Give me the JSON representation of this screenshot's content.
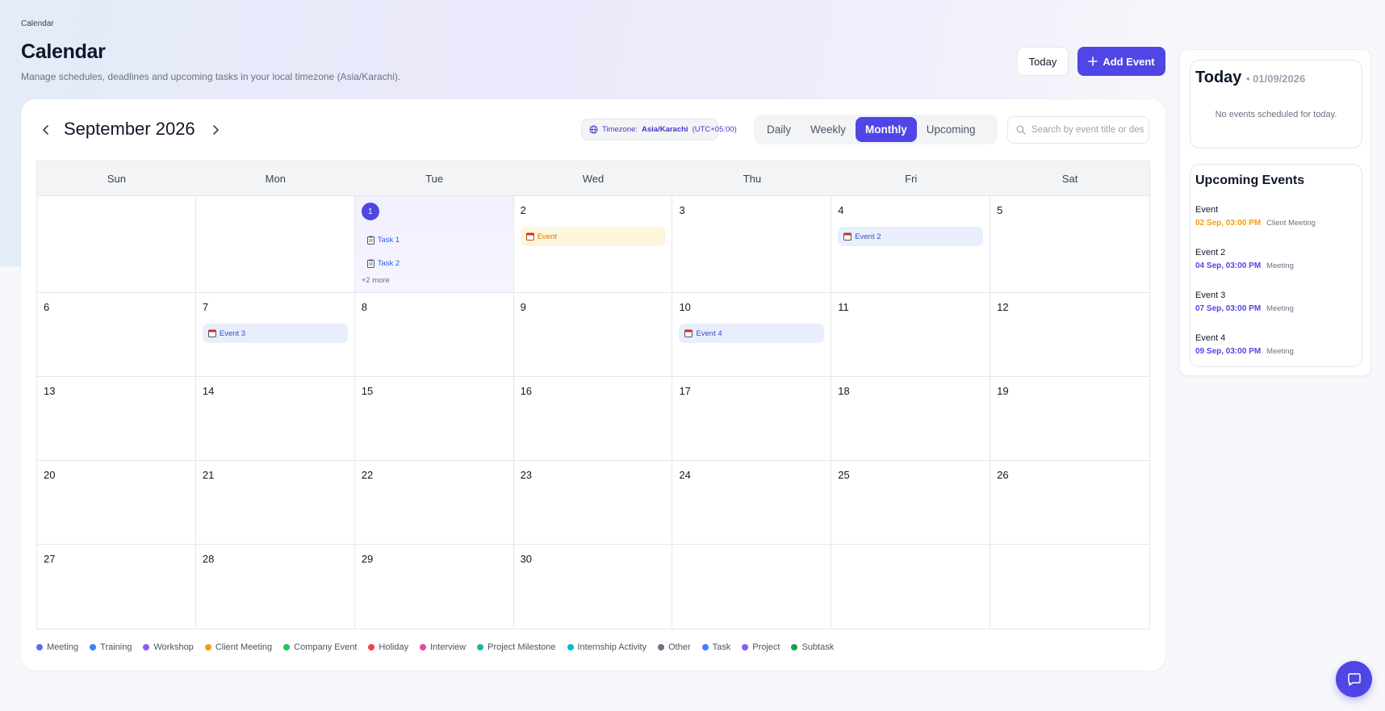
{
  "header": {
    "breadcrumb": "Calendar",
    "title": "Calendar",
    "subtitle": "Manage schedules, deadlines and upcoming tasks in your local timezone (Asia/Karachi).",
    "today_button": "Today",
    "add_event_button": "Add Event"
  },
  "toolbar": {
    "month_label": "September 2026",
    "timezone_prefix": "Timezone:",
    "timezone_name": "Asia/Karachi",
    "timezone_offset": "(UTC+05:00)",
    "views": [
      "Daily",
      "Weekly",
      "Monthly",
      "Upcoming"
    ],
    "active_view": "Monthly",
    "search_placeholder": "Search by event title or description"
  },
  "calendar": {
    "weekdays": [
      "Sun",
      "Mon",
      "Tue",
      "Wed",
      "Thu",
      "Fri",
      "Sat"
    ],
    "weeks": [
      [
        "",
        "",
        "1",
        "2",
        "3",
        "4",
        "5"
      ],
      [
        "6",
        "7",
        "8",
        "9",
        "10",
        "11",
        "12"
      ],
      [
        "13",
        "14",
        "15",
        "16",
        "17",
        "18",
        "19"
      ],
      [
        "20",
        "21",
        "22",
        "23",
        "24",
        "25",
        "26"
      ],
      [
        "27",
        "28",
        "29",
        "30",
        "",
        "",
        ""
      ]
    ],
    "today_day": "1",
    "events": {
      "task1": "Task 1",
      "task2": "Task 2",
      "more": "+2 more",
      "ev_sep2": "Event",
      "ev_sep4": "Event 2",
      "ev_sep7": "Event 3",
      "ev_sep10": "Event 4"
    }
  },
  "legend": [
    {
      "label": "Meeting",
      "color": "#6366f1"
    },
    {
      "label": "Training",
      "color": "#3b82f6"
    },
    {
      "label": "Workshop",
      "color": "#8b5cf6"
    },
    {
      "label": "Client Meeting",
      "color": "#f59e0b"
    },
    {
      "label": "Company Event",
      "color": "#22c55e"
    },
    {
      "label": "Holiday",
      "color": "#ef4444"
    },
    {
      "label": "Interview",
      "color": "#ec4899"
    },
    {
      "label": "Project Milestone",
      "color": "#14b8a6"
    },
    {
      "label": "Internship Activity",
      "color": "#06b6d4"
    },
    {
      "label": "Other",
      "color": "#6b7280"
    },
    {
      "label": "Task",
      "color": "#3b82f6"
    },
    {
      "label": "Project",
      "color": "#8b5cf6"
    },
    {
      "label": "Subtask",
      "color": "#16a34a"
    }
  ],
  "sidebar": {
    "today_title": "Today",
    "today_date": "• 01/09/2026",
    "no_events": "No events scheduled for today.",
    "upcoming_title": "Upcoming Events",
    "upcoming": [
      {
        "name": "Event",
        "time": "02 Sep, 03:00 PM",
        "category": "Client Meeting",
        "color": "#f59e0b"
      },
      {
        "name": "Event 2",
        "time": "04 Sep, 03:00 PM",
        "category": "Meeting",
        "color": "#4f46e5"
      },
      {
        "name": "Event 3",
        "time": "07 Sep, 03:00 PM",
        "category": "Meeting",
        "color": "#4f46e5"
      },
      {
        "name": "Event 4",
        "time": "09 Sep, 03:00 PM",
        "category": "Meeting",
        "color": "#4f46e5"
      }
    ]
  },
  "colors": {
    "accent": "#4f46e5",
    "client_meeting": "#f59e0b"
  },
  "icons": {
    "prev": "chevron-left-icon",
    "next": "chevron-right-icon",
    "timezone": "globe-icon",
    "search": "search-icon",
    "add": "plus-icon",
    "event": "calendar-icon",
    "task": "clipboard-icon",
    "chat": "chat-icon"
  }
}
